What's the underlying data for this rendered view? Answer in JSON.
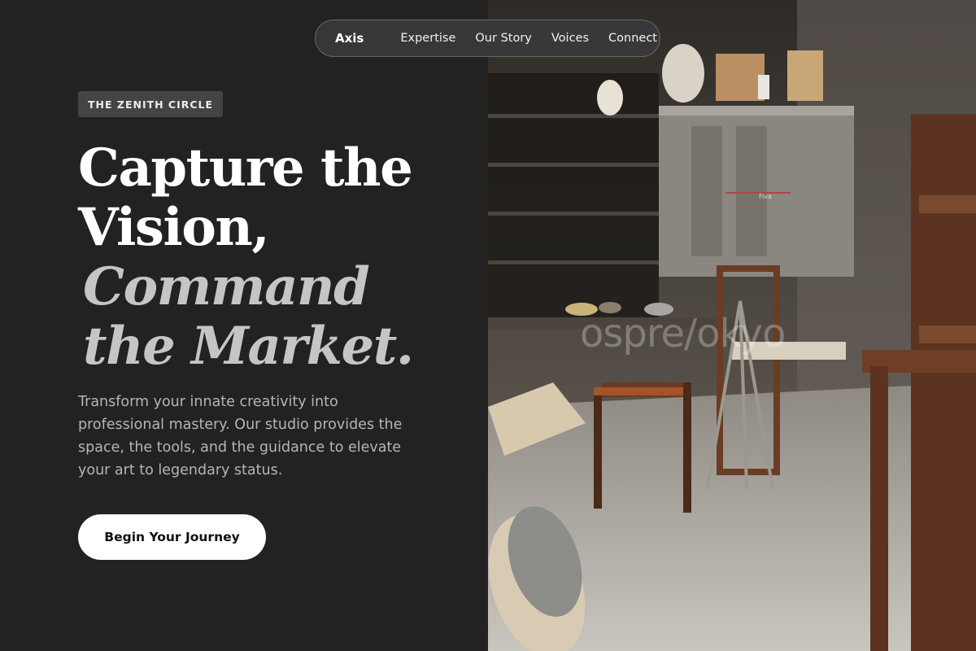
{
  "nav": {
    "brand": "Axis",
    "links": [
      "Expertise",
      "Our Story",
      "Voices",
      "Connect"
    ]
  },
  "hero": {
    "badge": "THE ZENITH CIRCLE",
    "headline": {
      "line1": "Capture the",
      "line2": "Vision,",
      "line3": "Command",
      "line4": "the Market."
    },
    "lead": "Transform your innate creativity into professional mastery. Our studio provides the space, the tools, and the guidance to elevate your art to legendary status.",
    "cta_label": "Begin Your Journey"
  },
  "image": {
    "watermark": "ospre/okyo",
    "kiln_label": "Fiva"
  },
  "colors": {
    "background": "#222222",
    "headline": "#ffffff",
    "headline_italic": "#c5c5c5",
    "cta_background": "#ffffff",
    "badge_background": "#444444"
  }
}
